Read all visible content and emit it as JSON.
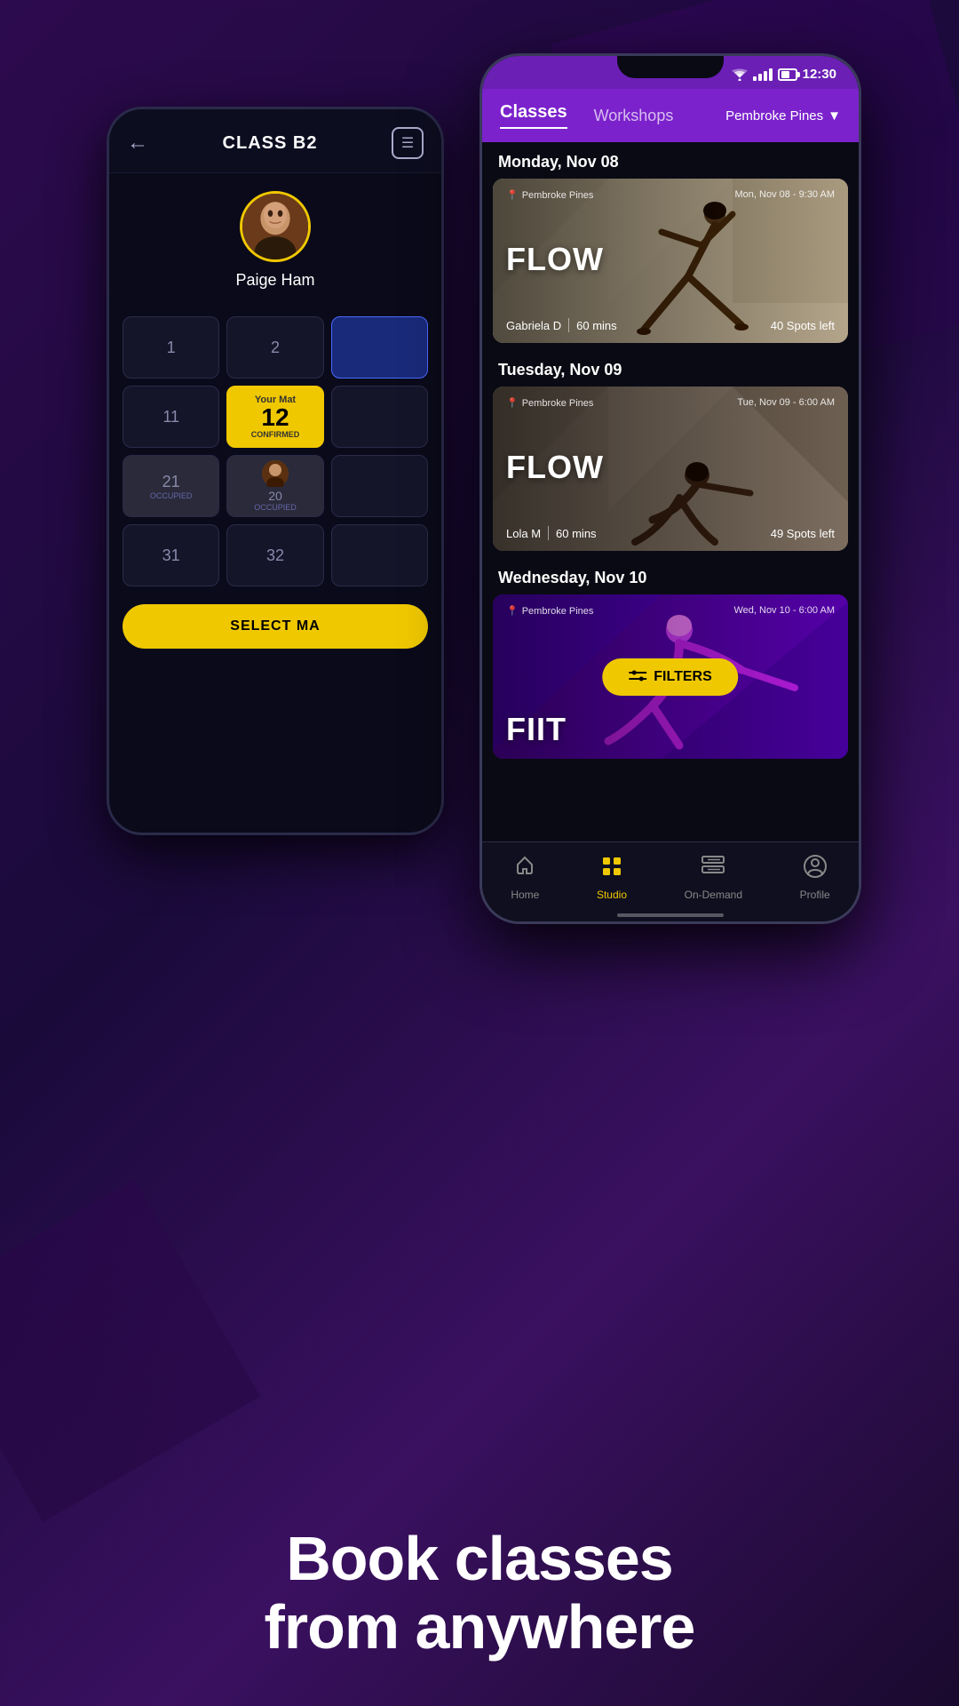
{
  "background": {
    "color": "#1a0a3a"
  },
  "phone_back": {
    "title": "CLASS B2",
    "back_button": "←",
    "menu_icon": "☰",
    "user": {
      "name": "Paige Ham",
      "avatar_emoji": "👩"
    },
    "mat_grid": {
      "cells": [
        {
          "id": "1",
          "number": "1",
          "type": "empty"
        },
        {
          "id": "2",
          "number": "2",
          "type": "empty"
        },
        {
          "id": "3",
          "number": "",
          "type": "blue"
        },
        {
          "id": "4",
          "number": "11",
          "type": "empty"
        },
        {
          "id": "5",
          "number": "12",
          "type": "confirmed",
          "label": "Your Mat",
          "status": "CONFIRMED"
        },
        {
          "id": "6",
          "number": "",
          "type": "empty"
        },
        {
          "id": "7",
          "number": "21",
          "type": "occupied",
          "status": "OCCUPIED"
        },
        {
          "id": "8",
          "number": "20",
          "type": "occupied-avatar",
          "status": "OCCUPIED"
        },
        {
          "id": "9",
          "number": "",
          "type": "empty"
        },
        {
          "id": "10",
          "number": "31",
          "type": "empty"
        },
        {
          "id": "11",
          "number": "32",
          "type": "empty"
        },
        {
          "id": "12",
          "number": "",
          "type": "empty"
        }
      ]
    },
    "select_button": "SELECT MA"
  },
  "phone_front": {
    "status_bar": {
      "time": "12:30"
    },
    "header": {
      "tab_classes": "Classes",
      "tab_workshops": "Workshops",
      "location": "Pembroke Pines",
      "location_arrow": "▼"
    },
    "days": [
      {
        "label": "Monday, Nov 08",
        "classes": [
          {
            "id": "mon-flow",
            "name": "FLOW",
            "location": "Pembroke Pines",
            "datetime": "Mon, Nov 08 - 9:30 AM",
            "instructor": "Gabriela D",
            "duration": "60 mins",
            "spots": "40 Spots left",
            "style": "tan"
          }
        ]
      },
      {
        "label": "Tuesday, Nov 09",
        "classes": [
          {
            "id": "tue-flow",
            "name": "FLOW",
            "location": "Pembroke Pines",
            "datetime": "Tue, Nov 09 - 6:00 AM",
            "instructor": "Lola M",
            "duration": "60 mins",
            "spots": "49 Spots left",
            "style": "dark-tan"
          }
        ]
      },
      {
        "label": "Wednesday, Nov 10",
        "classes": [
          {
            "id": "wed-fiit",
            "name": "FIIT",
            "location": "Pembroke Pines",
            "datetime": "Wed, Nov 10 - 6:00 AM",
            "instructor": "",
            "duration": "",
            "spots": "",
            "style": "purple"
          }
        ]
      }
    ],
    "filters_button": "FILTERS",
    "bottom_nav": {
      "items": [
        {
          "id": "home",
          "label": "Home",
          "icon": "🏠",
          "active": false
        },
        {
          "id": "studio",
          "label": "Studio",
          "icon": "⊞",
          "active": true
        },
        {
          "id": "on-demand",
          "label": "On-Demand",
          "icon": "▦",
          "active": false
        },
        {
          "id": "profile",
          "label": "Profile",
          "icon": "◎",
          "active": false
        }
      ]
    }
  },
  "tagline": {
    "line1": "Book classes",
    "line2": "from anywhere"
  }
}
